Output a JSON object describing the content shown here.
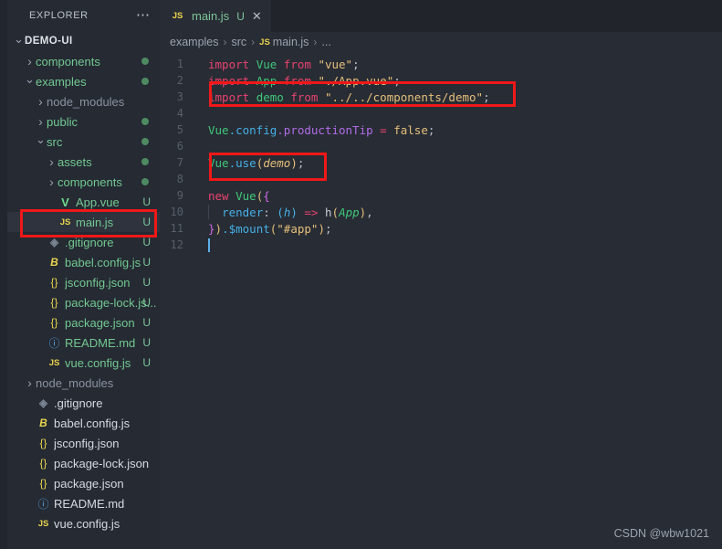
{
  "sidebar": {
    "header": {
      "title": "EXPLORER",
      "more_icon": "ellipsis-icon"
    },
    "root": {
      "label": "DEMO-UI",
      "chevron": "chevron-down-icon"
    },
    "items": [
      {
        "label": "components",
        "indent": 1,
        "chev": "closed",
        "kind": "folder",
        "color": "green",
        "dot": true,
        "badge": ""
      },
      {
        "label": "examples",
        "indent": 1,
        "chev": "open",
        "kind": "folder",
        "color": "green",
        "dot": true,
        "badge": ""
      },
      {
        "label": "node_modules",
        "indent": 2,
        "chev": "closed",
        "kind": "folder",
        "color": "grey",
        "dot": false,
        "badge": ""
      },
      {
        "label": "public",
        "indent": 2,
        "chev": "closed",
        "kind": "folder",
        "color": "green",
        "dot": true,
        "badge": ""
      },
      {
        "label": "src",
        "indent": 2,
        "chev": "open",
        "kind": "folder",
        "color": "green",
        "dot": true,
        "badge": ""
      },
      {
        "label": "assets",
        "indent": 3,
        "chev": "closed",
        "kind": "folder",
        "color": "green",
        "dot": true,
        "badge": ""
      },
      {
        "label": "components",
        "indent": 3,
        "chev": "closed",
        "kind": "folder",
        "color": "green",
        "dot": true,
        "badge": ""
      },
      {
        "label": "App.vue",
        "indent": 3,
        "chev": "blank",
        "kind": "vue",
        "color": "green",
        "dot": false,
        "badge": "U"
      },
      {
        "label": "main.js",
        "indent": 3,
        "chev": "blank",
        "kind": "js",
        "color": "green",
        "dot": false,
        "badge": "U",
        "selected": true
      },
      {
        "label": ".gitignore",
        "indent": 2,
        "chev": "blank",
        "kind": "git",
        "color": "green",
        "dot": false,
        "badge": "U"
      },
      {
        "label": "babel.config.js",
        "indent": 2,
        "chev": "blank",
        "kind": "babel",
        "color": "green",
        "dot": false,
        "badge": "U"
      },
      {
        "label": "jsconfig.json",
        "indent": 2,
        "chev": "blank",
        "kind": "json",
        "color": "green",
        "dot": false,
        "badge": "U"
      },
      {
        "label": "package-lock.js...",
        "indent": 2,
        "chev": "blank",
        "kind": "json",
        "color": "green",
        "dot": false,
        "badge": "U"
      },
      {
        "label": "package.json",
        "indent": 2,
        "chev": "blank",
        "kind": "json",
        "color": "green",
        "dot": false,
        "badge": "U"
      },
      {
        "label": "README.md",
        "indent": 2,
        "chev": "blank",
        "kind": "md",
        "color": "green",
        "dot": false,
        "badge": "U"
      },
      {
        "label": "vue.config.js",
        "indent": 2,
        "chev": "blank",
        "kind": "js",
        "color": "green",
        "dot": false,
        "badge": "U"
      },
      {
        "label": "node_modules",
        "indent": 1,
        "chev": "closed",
        "kind": "folder",
        "color": "grey",
        "dot": false,
        "badge": ""
      },
      {
        "label": ".gitignore",
        "indent": 1,
        "chev": "blank",
        "kind": "git",
        "color": "white",
        "dot": false,
        "badge": ""
      },
      {
        "label": "babel.config.js",
        "indent": 1,
        "chev": "blank",
        "kind": "babel",
        "color": "white",
        "dot": false,
        "badge": ""
      },
      {
        "label": "jsconfig.json",
        "indent": 1,
        "chev": "blank",
        "kind": "json",
        "color": "white",
        "dot": false,
        "badge": ""
      },
      {
        "label": "package-lock.json",
        "indent": 1,
        "chev": "blank",
        "kind": "json",
        "color": "white",
        "dot": false,
        "badge": ""
      },
      {
        "label": "package.json",
        "indent": 1,
        "chev": "blank",
        "kind": "json",
        "color": "white",
        "dot": false,
        "badge": ""
      },
      {
        "label": "README.md",
        "indent": 1,
        "chev": "blank",
        "kind": "md",
        "color": "white",
        "dot": false,
        "badge": ""
      },
      {
        "label": "vue.config.js",
        "indent": 1,
        "chev": "blank",
        "kind": "js",
        "color": "white",
        "dot": false,
        "badge": ""
      }
    ]
  },
  "editor": {
    "tab": {
      "icon": "js-file-icon",
      "icon_text": "JS",
      "label": "main.js",
      "status": "U",
      "close_icon": "✕"
    },
    "breadcrumb": {
      "parts": [
        "examples",
        "src",
        "main.js",
        "..."
      ],
      "file_icon_text": "JS",
      "separator": "›"
    },
    "line_numbers": [
      "1",
      "2",
      "3",
      "4",
      "5",
      "6",
      "7",
      "8",
      "9",
      "10",
      "11",
      "12"
    ],
    "code_lines": [
      "import Vue from \"vue\";",
      "import App from \"./App.vue\";",
      "import demo from \"../../components/demo\";",
      "",
      "Vue.config.productionTip = false;",
      "",
      "Vue.use(demo);",
      "",
      "new Vue({",
      "  render: (h) => h(App),",
      "}).$mount(\"#app\");",
      ""
    ],
    "tokens": {
      "import": "import",
      "from": "from",
      "vue_ident": "Vue",
      "app_ident": "App",
      "demo_ident": "demo",
      "str_vue": "\"vue\"",
      "str_app": "\"./App.vue\"",
      "str_demo": "\"../../components/demo\"",
      "config": ".config",
      "productionTip": ".productionTip",
      "equals": "=",
      "false_val": "false",
      "use": ".use",
      "new_kw": "new",
      "render": "render",
      "arrow": "=>",
      "h_fn": "h",
      "mount": ".$mount",
      "str_app_id": "\"#app\"",
      "semi": ";"
    }
  },
  "annotations": {
    "boxes": [
      {
        "name": "highlight-import-demo",
        "target": "line 3 import demo",
        "color": "#f01818"
      },
      {
        "name": "highlight-vue-use",
        "target": "line 7 Vue.use(demo)",
        "color": "#f01818"
      },
      {
        "name": "highlight-mainjs-file",
        "target": "sidebar main.js",
        "color": "#f01818"
      }
    ]
  },
  "watermark": {
    "text": "CSDN @wbw1021"
  },
  "colors": {
    "sidebar_bg": "#252a33",
    "editor_bg": "#282c34",
    "tabbar_bg": "#21252b",
    "accent_green": "#73c991",
    "annotation_red": "#f01818",
    "linenum": "#575f6b"
  }
}
